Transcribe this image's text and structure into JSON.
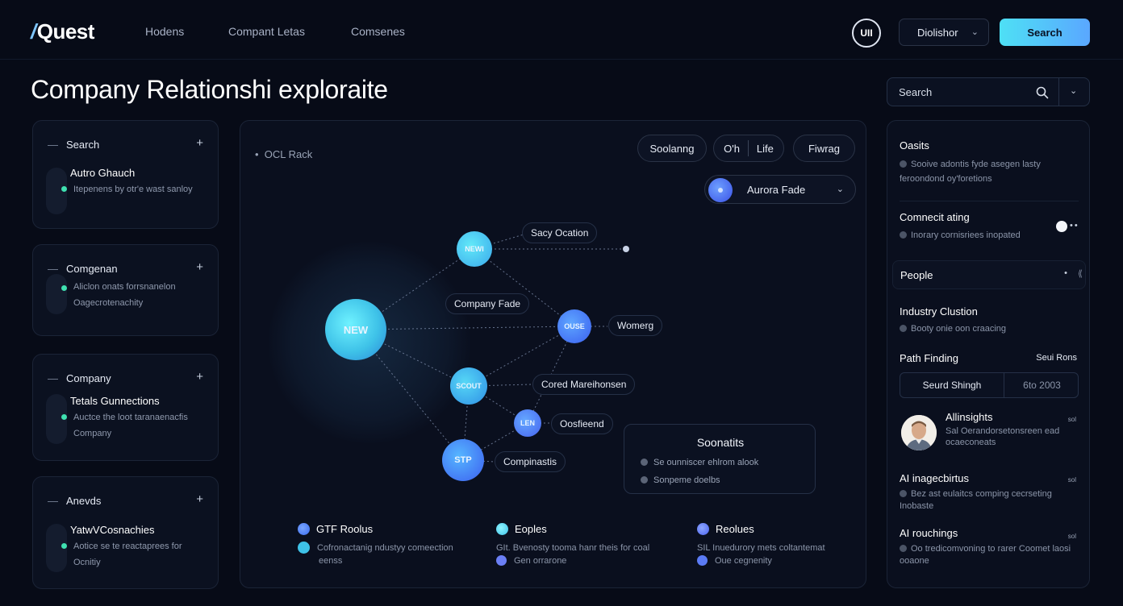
{
  "app": {
    "logo": "Quest",
    "nav": [
      "Hodens",
      "Compant Letas",
      "Comsenes"
    ],
    "avatar_label": "UII",
    "dropdown_label": "Diolishor",
    "search_button": "Search"
  },
  "page_title": "Company Relationshi exploraite",
  "right_search": {
    "label": "Search"
  },
  "left_cards": [
    {
      "header": "Search",
      "title": "Autro Ghauch",
      "desc": "Itepenens by otr'e wast sanloy"
    },
    {
      "header": "Comgenan",
      "title": "",
      "desc": "Aliclon onats forrsnanelon Oagecrotenachity"
    },
    {
      "header": "Company",
      "title": "Tetals Gunnections",
      "desc": "Auctce the loot taranaenacfis Company"
    },
    {
      "header": "Anevds",
      "title": "YatwVCosnachies",
      "desc": "Aotice se te reactaprees for Ocnitiy"
    }
  ],
  "graph": {
    "breadcrumb": "OCL Rack",
    "chips": [
      "Soolanng",
      "O'h",
      "Life",
      "Fiwrag"
    ],
    "node_selector": "Aurora Fade",
    "nodes": [
      "NEW",
      "NEWI",
      "OUSE",
      "SCOUT",
      "LEN",
      "STP"
    ],
    "edge_labels": [
      "Sacy Ocation",
      "Company Fade",
      "Womerg",
      "Cored Mareihonsen",
      "Oosfieend",
      "Compinastis"
    ],
    "insight": {
      "title": "Soonatits",
      "rows": [
        "Se ounniscer ehlrom alook",
        "Sonpeme doelbs"
      ]
    },
    "legend": [
      {
        "title": "GTF Roolus",
        "desc1": "Cofronactanig ndustyy comeection",
        "desc2": "eenss",
        "color": "#3a6df0"
      },
      {
        "title": "Eoples",
        "desc1": "GIt. Bvenosty tooma hanr theis for coal",
        "desc2": "Gen orrarone",
        "color": "#4fd3e8"
      },
      {
        "title": "Reolues",
        "desc1": "SIL Inuedurory mets coltantemat",
        "desc2": "Oue cegnenity",
        "color": "#5b7bf5"
      }
    ]
  },
  "right_panel": {
    "sections": [
      {
        "title": "Oasits",
        "desc": "Sooive adontis fyde asegen lasty feroondond oy'foretions"
      },
      {
        "title": "Comnecit ating",
        "desc": "Inorary cornisriees inopated"
      },
      {
        "title": "People",
        "desc": ""
      },
      {
        "title": "Industry Clustion",
        "desc": "Booty onie oon craacing"
      },
      {
        "title": "Path Finding",
        "desc": ""
      }
    ],
    "path_finding_right": "Seui Rons",
    "path_box": {
      "left": "Seurd Shingh",
      "right": "6to 2003"
    },
    "insights": [
      {
        "title": "Allinsights",
        "desc": "Sal Oerandorsetonsreen ead ocaeconeats",
        "tag": "sol"
      },
      {
        "title": "AI inagecbirtus",
        "desc": "Bez ast eulaitcs comping cecrseting Inobaste",
        "tag": "sol"
      },
      {
        "title": "AI rouchings",
        "desc": "Oo tredicomvoning to rarer Coomet laosi ooaone",
        "tag": "sol"
      }
    ]
  }
}
